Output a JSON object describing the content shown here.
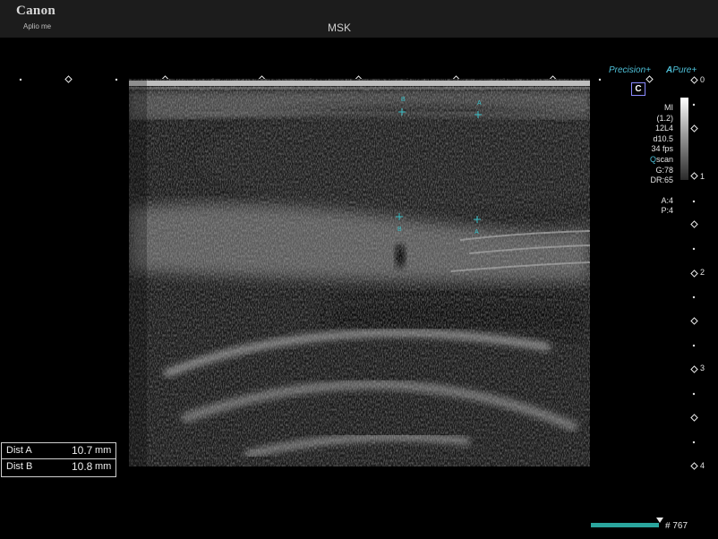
{
  "header": {
    "brand": "Canon",
    "model": "Aplio me",
    "preset": "MSK"
  },
  "imaging_modes": {
    "precision_label": "Precision",
    "apure_a": "A",
    "apure_label": "Pure",
    "plus": "+",
    "mode_badge": "C"
  },
  "params": {
    "mi_label": "MI",
    "mi_value": "(1.2)",
    "probe": "12L4",
    "depth": "d10.5",
    "fps": "34 fps",
    "qscan_q": "Q",
    "qscan_rest": "scan",
    "gain": "G:78",
    "dynamic_range": "DR:65",
    "a_value": "A:4",
    "p_value": "P:4"
  },
  "depth_scale": {
    "labels": [
      "0",
      "1",
      "2",
      "3",
      "4"
    ]
  },
  "calipers": {
    "top_b": "B",
    "top_a": "A",
    "bottom_b": "B",
    "bottom_a": "A"
  },
  "measurements": [
    {
      "name": "Dist A",
      "value": "10.7",
      "unit": "mm"
    },
    {
      "name": "Dist B",
      "value": "10.8",
      "unit": "mm"
    }
  ],
  "cine": {
    "frame_label": "# 767"
  },
  "colors": {
    "accent": "#4ec0d8",
    "caliper": "#39c0c8",
    "cine": "#2aa59d"
  }
}
